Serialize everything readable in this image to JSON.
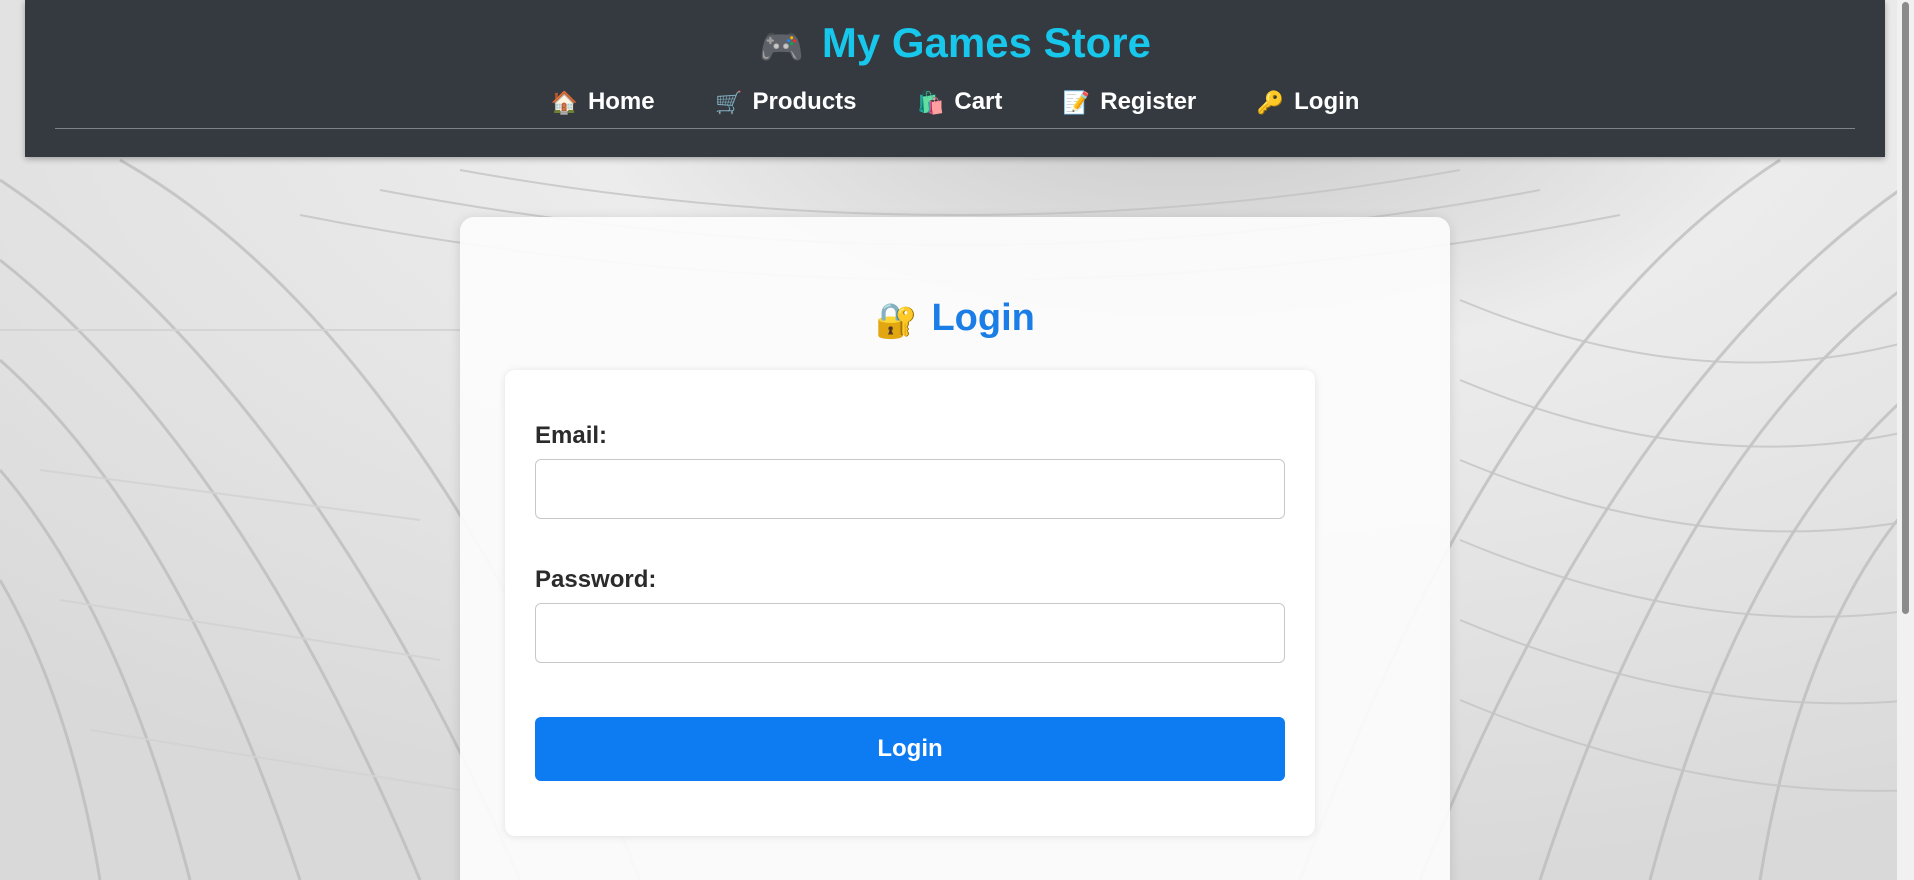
{
  "header": {
    "brand_icon": "game-controller-icon",
    "brand_icon_glyph": "🎮",
    "brand_title": "My Games Store",
    "brand_color": "#17c7ec",
    "background_color": "#343a40"
  },
  "nav": {
    "items": [
      {
        "label": "Home",
        "icon": "house-icon",
        "glyph": "🏠"
      },
      {
        "label": "Products",
        "icon": "cart-icon",
        "glyph": "🛒"
      },
      {
        "label": "Cart",
        "icon": "shopping-bags-icon",
        "glyph": "🛍️"
      },
      {
        "label": "Register",
        "icon": "memo-icon",
        "glyph": "📝"
      },
      {
        "label": "Login",
        "icon": "key-icon",
        "glyph": "🔑"
      }
    ]
  },
  "login_card": {
    "title_icon": "lock-with-key-icon",
    "title_icon_glyph": "🔐",
    "title": "Login",
    "title_color": "#1a7ee6"
  },
  "form": {
    "email_label": "Email:",
    "email_value": "",
    "password_label": "Password:",
    "password_value": "",
    "submit_label": "Login",
    "submit_color": "#0d7bf2"
  }
}
